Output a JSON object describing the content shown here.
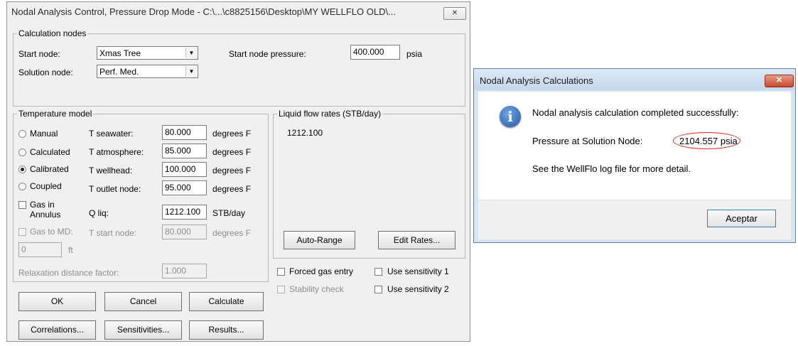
{
  "nodal_dialog": {
    "title": "Nodal Analysis Control, Pressure Drop Mode - C:\\...\\c8825156\\Desktop\\MY WELLFLO OLD\\...",
    "close_label": "✕",
    "calc_nodes": {
      "group_label": "Calculation nodes",
      "start_node_label": "Start node:",
      "start_node_value": "Xmas Tree",
      "start_pressure_label": "Start node pressure:",
      "start_pressure_value": "400.000",
      "start_pressure_unit": "psia",
      "solution_node_label": "Solution node:",
      "solution_node_value": "Perf. Med."
    },
    "temperature_model": {
      "group_label": "Temperature model",
      "options": [
        "Manual",
        "Calculated",
        "Calibrated",
        "Coupled"
      ],
      "selected": "Calibrated",
      "gas_in_annulus_label": "Gas in Annulus",
      "gas_to_md_label": "Gas to MD:",
      "gas_to_md_value": "0",
      "gas_to_md_unit": "ft",
      "t_seawater_label": "T seawater:",
      "t_seawater_value": "80.000",
      "t_atmosphere_label": "T atmosphere:",
      "t_atmosphere_value": "85.000",
      "t_wellhead_label": "T wellhead:",
      "t_wellhead_value": "100.000",
      "t_outlet_label": "T outlet node:",
      "t_outlet_value": "95.000",
      "q_liq_label": "Q liq:",
      "q_liq_value": "1212.100",
      "q_liq_unit": "STB/day",
      "t_start_label": "T start node:",
      "t_start_value": "80.000",
      "temp_unit": "degrees F",
      "relaxation_label": "Relaxation distance factor:",
      "relaxation_value": "1.000"
    },
    "liquid_flow": {
      "group_label": "Liquid flow rates (STB/day)",
      "rates": [
        "1212.100"
      ],
      "auto_range_label": "Auto-Range",
      "edit_rates_label": "Edit Rates..."
    },
    "checks": {
      "forced_gas_entry": "Forced gas entry",
      "stability_check": "Stability check",
      "use_sensitivity_1": "Use sensitivity 1",
      "use_sensitivity_2": "Use sensitivity 2"
    },
    "buttons": {
      "ok": "OK",
      "cancel": "Cancel",
      "calculate": "Calculate",
      "correlations": "Correlations...",
      "sensitivities": "Sensitivities...",
      "results": "Results..."
    }
  },
  "result_dialog": {
    "title": "Nodal Analysis Calculations",
    "close_label": "✕",
    "icon": "info-icon",
    "message": "Nodal analysis calculation completed successfully:",
    "pressure_label": "Pressure at Solution Node:",
    "pressure_value": "2104.557 psia",
    "log_hint": "See the WellFlo log file for more detail.",
    "accept_label": "Aceptar",
    "highlight_color": "#e0251a"
  }
}
